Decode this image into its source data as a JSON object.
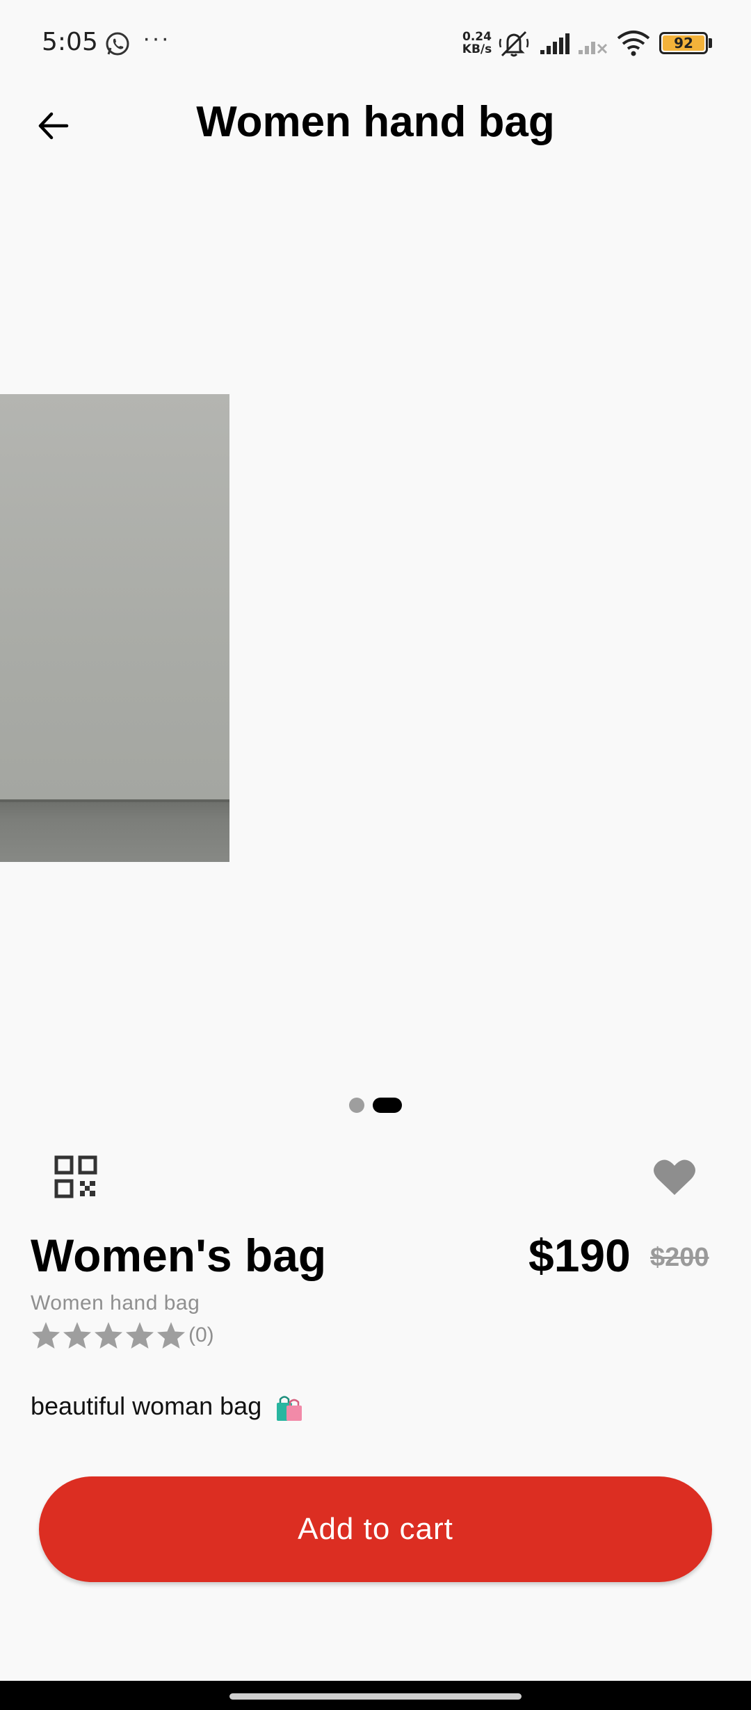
{
  "status_bar": {
    "time": "5:05",
    "more": "···",
    "net_speed_value": "0.24",
    "net_speed_unit": "KB/s",
    "battery": "92",
    "icons": [
      "whatsapp-icon",
      "mute-icon",
      "signal-icon",
      "signal-icon",
      "wifi-icon",
      "battery-icon"
    ]
  },
  "header": {
    "title": "Women hand bag",
    "back_icon": "arrow-left-icon"
  },
  "carousel": {
    "page_count": 2,
    "active_page": 2
  },
  "product": {
    "name": "Women's bag",
    "price": "$190",
    "old_price": "$200",
    "category": "Women hand bag",
    "rating_count": "(0)",
    "stars": 0,
    "max_stars": 5,
    "description": "beautiful woman bag",
    "description_emoji": "shopping-bags-icon"
  },
  "actions": {
    "qr_icon": "qr-code-icon",
    "favorite_icon": "heart-icon",
    "add_to_cart_label": "Add to cart"
  },
  "colors": {
    "accent": "#dc2e22",
    "muted_text": "#8f8f8f",
    "star_inactive": "#9e9e9e",
    "background": "#f9f9f9"
  }
}
